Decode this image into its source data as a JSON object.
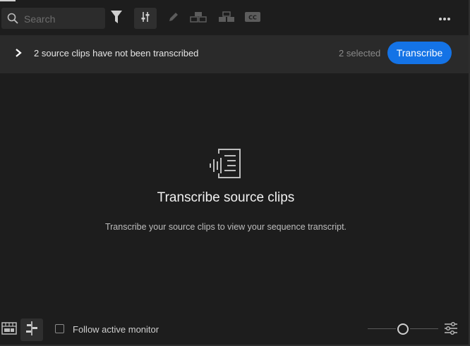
{
  "toolbar": {
    "search_placeholder": "Search",
    "icons": [
      "search-icon",
      "filter-icon",
      "tune-icon",
      "pencil-icon",
      "merge-up-icon",
      "merge-down-icon",
      "captions-icon",
      "more-icon"
    ]
  },
  "banner": {
    "message": "2 source clips have not been transcribed",
    "selected_text": "2 selected",
    "transcribe_label": "Transcribe",
    "accent_color": "#1473e6"
  },
  "empty_state": {
    "title": "Transcribe source clips",
    "description": "Transcribe your source clips to view your sequence transcript."
  },
  "bottom_bar": {
    "follow_label": "Follow active monitor"
  }
}
